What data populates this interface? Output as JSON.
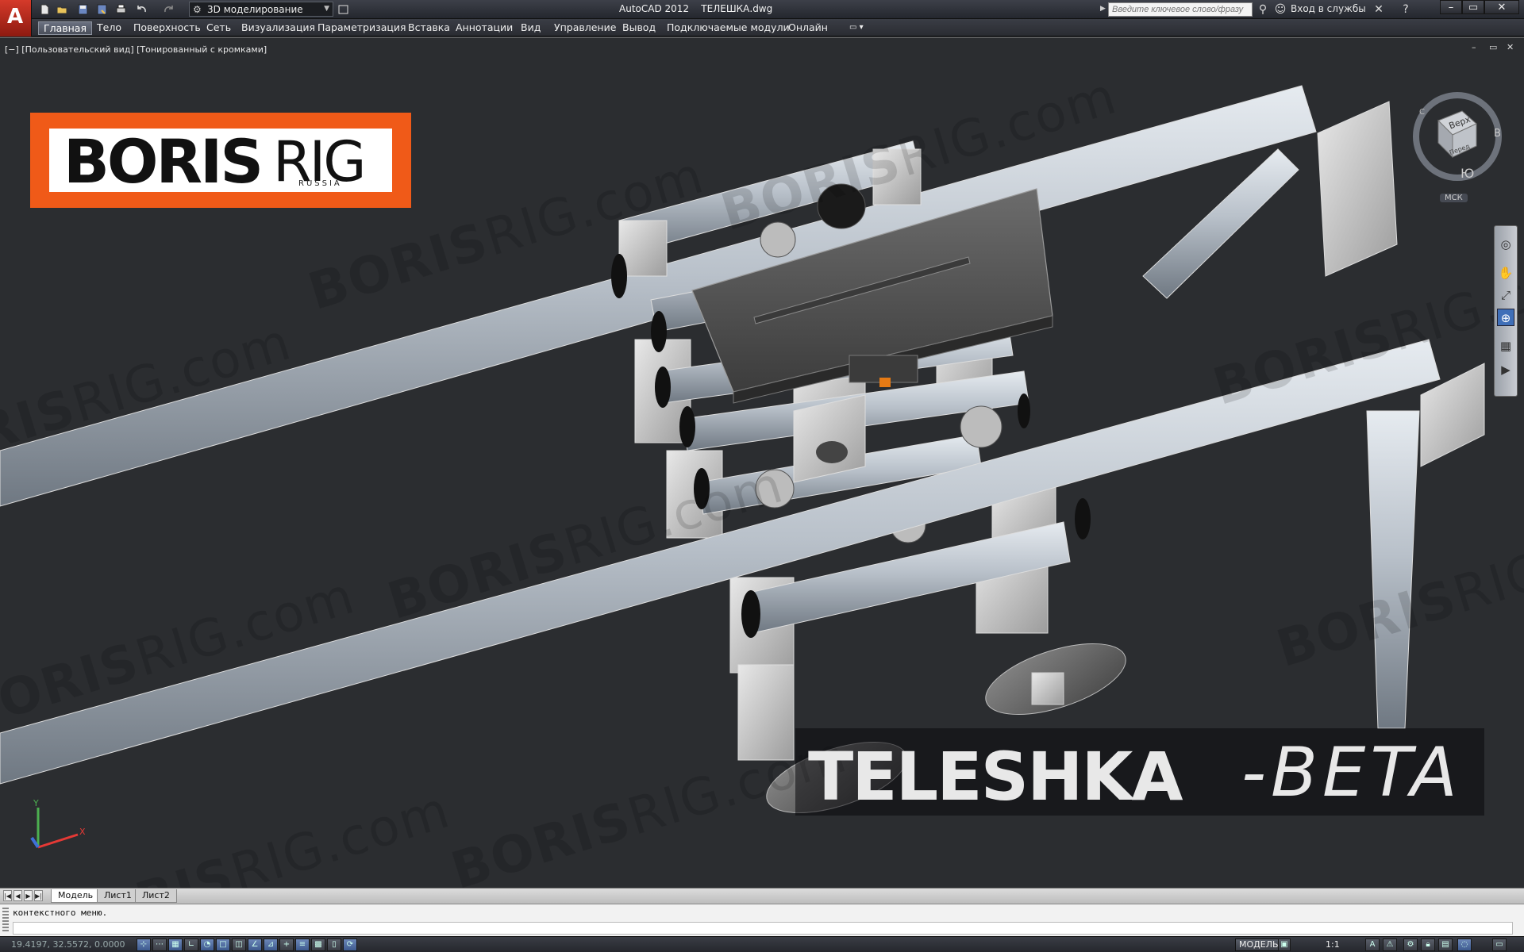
{
  "app": {
    "logo_letter": "A",
    "title": "AutoCAD 2012    ТЕЛЕШКА.dwg",
    "workspace": "3D моделирование"
  },
  "search": {
    "placeholder": "Введите ключевое слово/фразу"
  },
  "signin_label": "Вход в службы",
  "menu": [
    "Главная",
    "Тело",
    "Поверхность",
    "Сеть",
    "Визуализация",
    "Параметризация",
    "Вставка",
    "Аннотации",
    "Вид",
    "Управление",
    "Вывод",
    "Подключаемые модули",
    "Онлайн"
  ],
  "viewport": {
    "label": "[−] [Пользовательский вид] [Тонированный с кромками]",
    "brand_bold": "BORIS",
    "brand_thin": "RIG",
    "brand_sub": "RUSSIA",
    "banner_bold": "TELESHKA",
    "banner_thin": "-BETA",
    "watermark_bold": "BORIS",
    "watermark_thin": "RIG.com"
  },
  "viewcube": {
    "face_top": "Верх",
    "face_front": "Перед",
    "compass_east": "В",
    "compass_south": "Ю",
    "compass_north": "С",
    "wcs": "МСК"
  },
  "ucs": {
    "x": "X",
    "y": "Y"
  },
  "layout_tabs": [
    "Модель",
    "Лист1",
    "Лист2"
  ],
  "command": {
    "history": "контекстного меню."
  },
  "status": {
    "coords": "19.4197, 32.5572, 0.0000",
    "space": "МОДЕЛЬ",
    "scale": "1:1"
  },
  "colors": {
    "brand_orange": "#f05a18",
    "viewport_bg": "#2b2d30",
    "autocad_red": "#c8291c"
  }
}
